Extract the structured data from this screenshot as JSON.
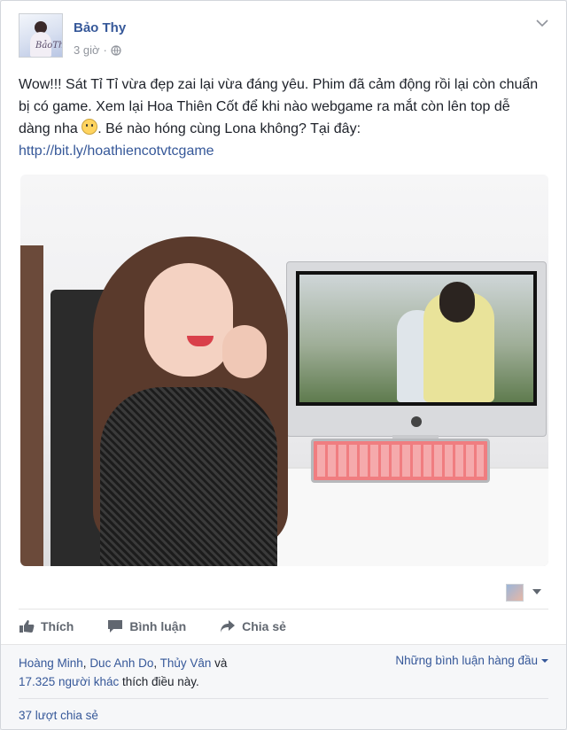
{
  "post": {
    "author": "Bảo Thy",
    "avatar_signature": "BảoThy",
    "time": "3 giờ",
    "message_main": "Wow!!! Sát Tỉ Tỉ vừa đẹp zai lại vừa đáng yêu. Phim đã cảm động rồi lại còn chuẩn bị có game. Xem lại Hoa Thiên Cốt để khi nào webgame ra mắt còn lên top dễ dàng nha ",
    "message_after_emoji": ". Bé nào hóng cùng Lona không? Tại đây:",
    "link": "http://bit.ly/hoathiencotvtcgame"
  },
  "actions": {
    "like": "Thích",
    "comment": "Bình luận",
    "share": "Chia sẻ"
  },
  "footer": {
    "likers": [
      "Hoàng Minh",
      "Duc Anh Do",
      "Thủy Vân"
    ],
    "sep1": ", ",
    "sep2": ", ",
    "and": " và ",
    "others": "17.325 người khác",
    "likes_suffix": " thích điều này.",
    "sort_label": "Những bình luận hàng đầu",
    "shares": "37 lượt chia sẻ"
  },
  "colors": {
    "link": "#365899",
    "muted": "#90949c",
    "action": "#616770"
  },
  "icons": [
    "globe-icon",
    "chevron-down-icon",
    "like-icon",
    "comment-icon",
    "share-icon",
    "caret-down-icon"
  ]
}
